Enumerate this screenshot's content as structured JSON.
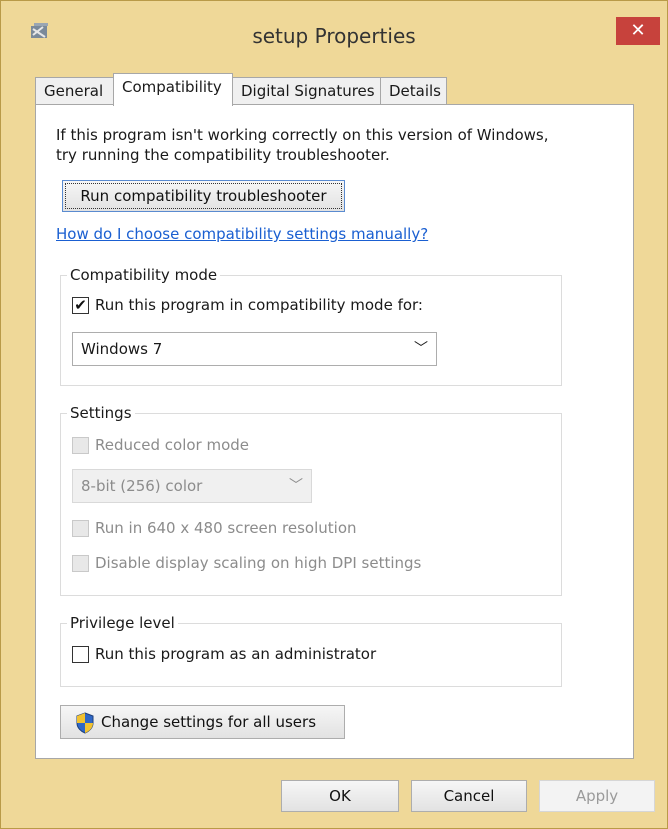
{
  "window": {
    "title": "setup Properties",
    "close_symbol": "✕"
  },
  "tabs": [
    {
      "label": "General",
      "active": false
    },
    {
      "label": "Compatibility",
      "active": true
    },
    {
      "label": "Digital Signatures",
      "active": false
    },
    {
      "label": "Details",
      "active": false
    }
  ],
  "intro": {
    "line1": "If this program isn't working correctly on this version of Windows,",
    "line2": "try running the compatibility troubleshooter."
  },
  "troubleshooter_button": "Run compatibility troubleshooter",
  "manual_link": "How do I choose compatibility settings manually?",
  "compat_mode": {
    "legend": "Compatibility mode",
    "checkbox_label": "Run this program in compatibility mode for:",
    "checked": true,
    "selected_os": "Windows 7"
  },
  "settings": {
    "legend": "Settings",
    "reduced_color": "Reduced color mode",
    "color_depth": "8-bit (256) color",
    "resolution_640": "Run in 640 x 480 screen resolution",
    "disable_dpi": "Disable display scaling on high DPI settings"
  },
  "privilege": {
    "legend": "Privilege level",
    "run_as_admin": "Run this program as an administrator"
  },
  "change_all_users": "Change settings for all users",
  "footer": {
    "ok": "OK",
    "cancel": "Cancel",
    "apply": "Apply"
  },
  "colors": {
    "title_bar": "#efd898",
    "close_button": "#c7423c",
    "link": "#1a5fd1",
    "disabled_text": "#8c8c8c"
  },
  "icons": {
    "app": "program-icon",
    "close": "close-icon",
    "check": "checkmark-icon",
    "dropdown": "chevron-down-icon",
    "uac": "uac-shield-icon"
  }
}
